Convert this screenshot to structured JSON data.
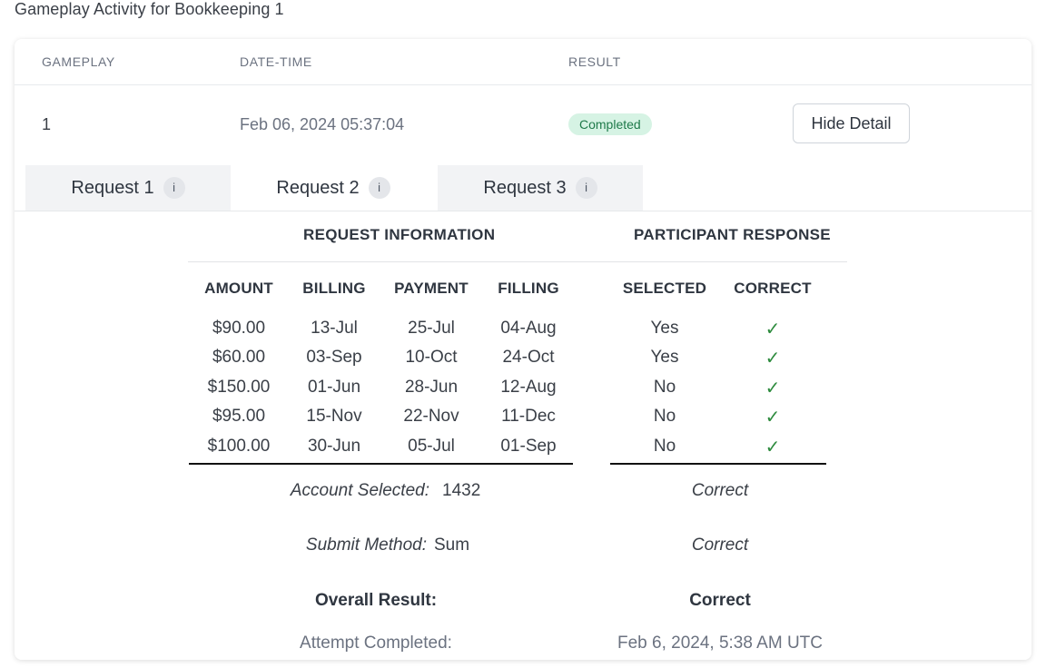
{
  "page": {
    "title": "Gameplay Activity for Bookkeeping 1"
  },
  "table": {
    "headers": {
      "gameplay": "GAMEPLAY",
      "datetime": "DATE-TIME",
      "result": "RESULT"
    },
    "row": {
      "gameplay": "1",
      "datetime": "Feb 06, 2024 05:37:04",
      "result": "Completed",
      "action_label": "Hide Detail"
    }
  },
  "tabs": [
    {
      "label": "Request 1",
      "info": "i",
      "active": false
    },
    {
      "label": "Request 2",
      "info": "i",
      "active": true
    },
    {
      "label": "Request 3",
      "info": "i",
      "active": false
    }
  ],
  "detail": {
    "request_info_title": "REQUEST INFORMATION",
    "participant_title": "PARTICIPANT RESPONSE",
    "columns": {
      "amount": "AMOUNT",
      "billing": "BILLING",
      "payment": "PAYMENT",
      "filling": "FILLING",
      "selected": "SELECTED",
      "correct": "CORRECT"
    },
    "rows": [
      {
        "amount": "$90.00",
        "billing": "13-Jul",
        "payment": "25-Jul",
        "filling": "04-Aug",
        "selected": "Yes",
        "correct": "✓"
      },
      {
        "amount": "$60.00",
        "billing": "03-Sep",
        "payment": "10-Oct",
        "filling": "24-Oct",
        "selected": "Yes",
        "correct": "✓"
      },
      {
        "amount": "$150.00",
        "billing": "01-Jun",
        "payment": "28-Jun",
        "filling": "12-Aug",
        "selected": "No",
        "correct": "✓"
      },
      {
        "amount": "$95.00",
        "billing": "15-Nov",
        "payment": "22-Nov",
        "filling": "11-Dec",
        "selected": "No",
        "correct": "✓"
      },
      {
        "amount": "$100.00",
        "billing": "30-Jun",
        "payment": "05-Jul",
        "filling": "01-Sep",
        "selected": "No",
        "correct": "✓"
      }
    ],
    "account_selected_label": "Account Selected:",
    "account_selected_value": "1432",
    "account_selected_result": "Correct",
    "submit_method_label": "Submit Method:",
    "submit_method_value": "Sum",
    "submit_method_result": "Correct",
    "overall_label": "Overall Result:",
    "overall_value": "Correct",
    "attempt_label": "Attempt Completed:",
    "attempt_value": "Feb 6, 2024, 5:38 AM UTC"
  },
  "colors": {
    "badge_bg": "#d6f3e4",
    "badge_text": "#1f7a4a",
    "check": "#2e8b3e",
    "tab_inactive_bg": "#f2f3f5"
  }
}
